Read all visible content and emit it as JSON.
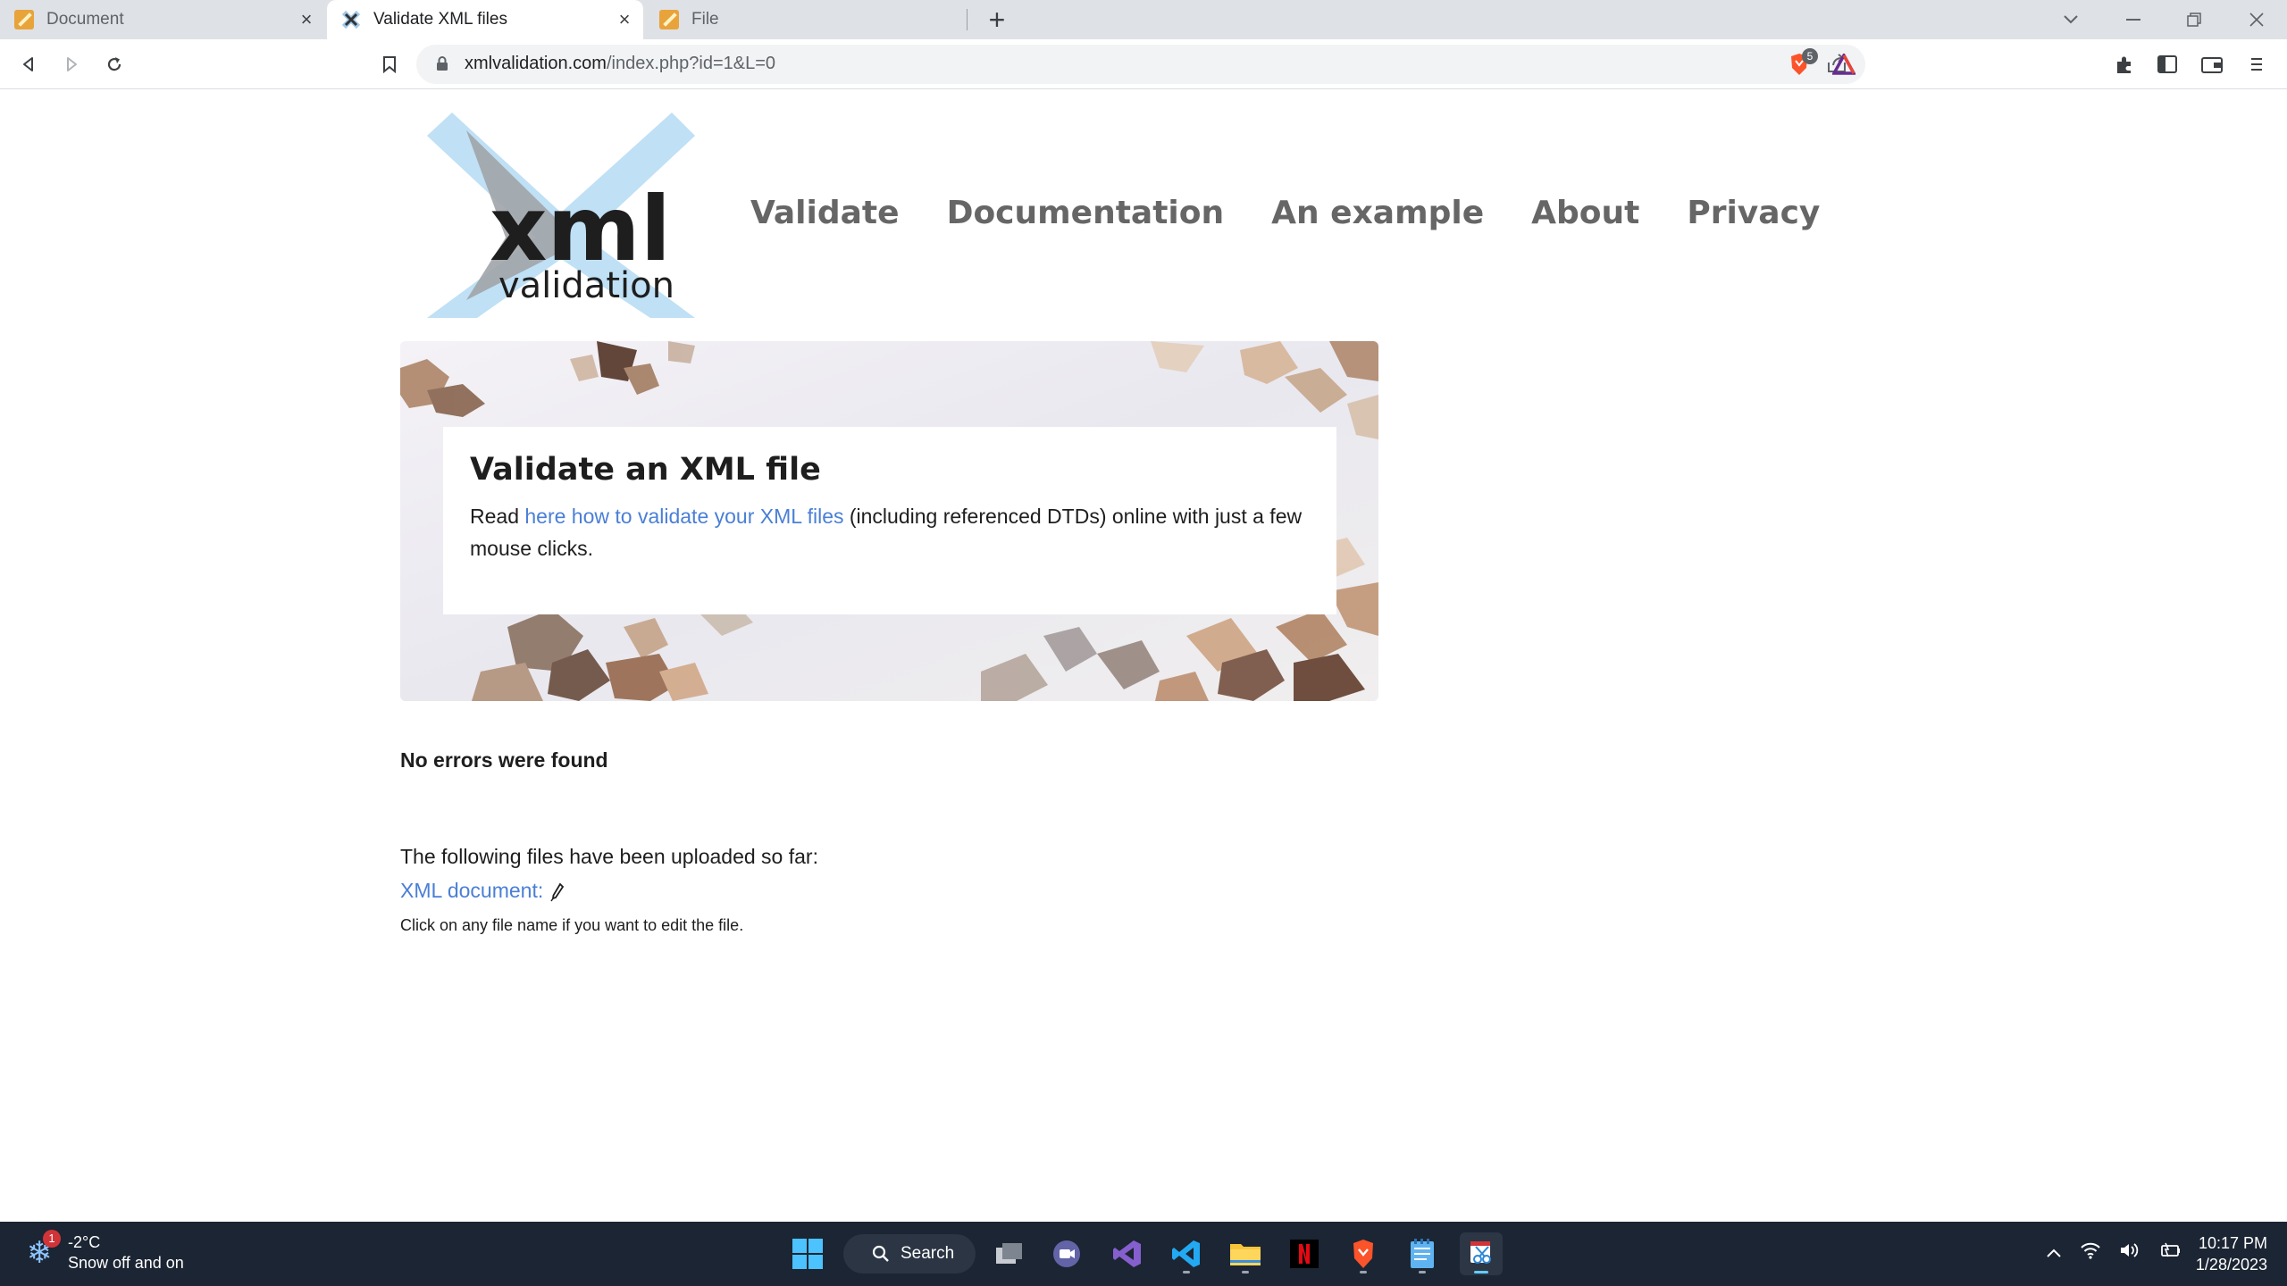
{
  "browser": {
    "tabs": [
      {
        "title": "Document",
        "favicon": "pencil-icon"
      },
      {
        "title": "Validate XML files",
        "favicon": "xml-x-icon"
      },
      {
        "title": "File",
        "favicon": "pencil-icon"
      }
    ],
    "active_tab": 1,
    "url_host": "xmlvalidation.com",
    "url_path": "/index.php?id=1&L=0",
    "brave_shield_count": "5"
  },
  "site": {
    "logo_main": "xml",
    "logo_sub": "validation",
    "nav": [
      "Validate",
      "Documentation",
      "An example",
      "About",
      "Privacy"
    ],
    "hero": {
      "title": "Validate an XML file",
      "text_before": "Read ",
      "link_text": "here how to validate your XML files",
      "text_after": " (including referenced DTDs) online with just a few mouse clicks."
    },
    "result": "No errors were found",
    "files_intro": "The following files have been uploaded so far:",
    "file_link": "XML document:",
    "edit_hint": "Click on any file name if you want to edit the file."
  },
  "taskbar": {
    "weather_temp": "-2°C",
    "weather_desc": "Snow off and on",
    "weather_badge": "1",
    "search_label": "Search",
    "time": "10:17 PM",
    "date": "1/28/2023"
  },
  "colors": {
    "link": "#4a7fd6",
    "nav": "#666666",
    "taskbar": "#1c2533",
    "logo_x": "#bfe0f5"
  }
}
